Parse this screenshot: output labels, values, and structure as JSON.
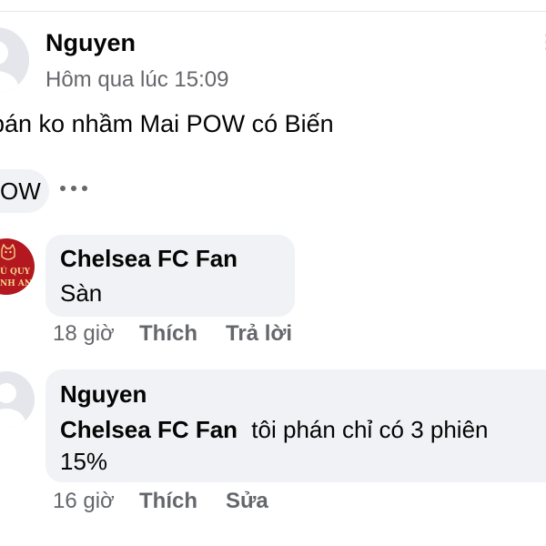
{
  "post": {
    "author": "Nguyen",
    "time": "Hôm qua lúc 15:09",
    "text": "pán ko nhầm Mai POW có Biến",
    "more_icon": "more-vertical-icon",
    "reaction_label": "OW",
    "reaction_more_icon": "more-horizontal-icon"
  },
  "comments": [
    {
      "author": "Chelsea FC Fan",
      "text": "Sàn",
      "avatar": {
        "line1": "Ú QUY",
        "line2": "NH AN"
      },
      "time": "18 giờ",
      "like_label": "Thích",
      "reply_label": "Trả lời"
    },
    {
      "author": "Nguyen",
      "mention": "Chelsea FC Fan",
      "text_line1": "tôi phán chỉ có 3 phiên",
      "text_line2": "15%",
      "time": "16 giờ",
      "like_label": "Thích",
      "edit_label": "Sửa"
    }
  ],
  "colors": {
    "meta_gray": "#65676b",
    "bubble_bg": "#f0f2f5",
    "avatar_red": "#b3171f"
  }
}
